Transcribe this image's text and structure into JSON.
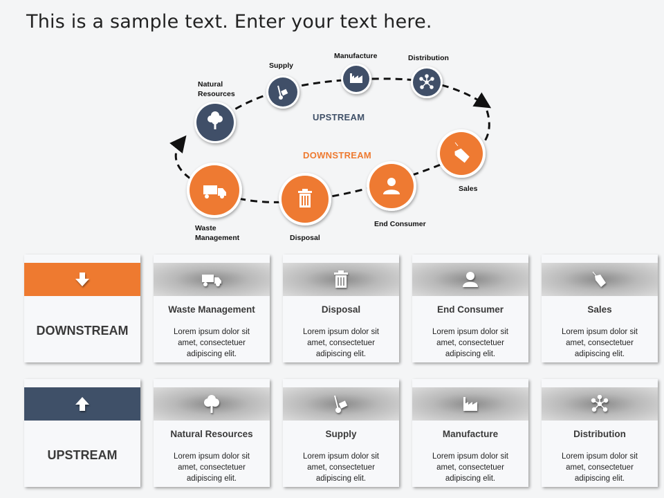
{
  "title": "This is a sample text. Enter your text here.",
  "colors": {
    "orange": "#ee7a30",
    "navy": "#3f5068",
    "dash": "#111111"
  },
  "diagram": {
    "upstream_label": "UPSTREAM",
    "downstream_label": "DOWNSTREAM",
    "upstream_nodes": [
      {
        "label": "Natural Resources",
        "icon": "tree-icon"
      },
      {
        "label": "Supply",
        "icon": "hand-truck-icon"
      },
      {
        "label": "Manufacture",
        "icon": "factory-icon"
      },
      {
        "label": "Distribution",
        "icon": "network-icon"
      }
    ],
    "downstream_nodes": [
      {
        "label": "Sales",
        "icon": "price-tag-icon"
      },
      {
        "label": "End Consumer",
        "icon": "user-icon"
      },
      {
        "label": "Disposal",
        "icon": "trash-icon"
      },
      {
        "label": "Waste Management",
        "icon": "dump-truck-icon"
      }
    ],
    "label_lines": {
      "natural_resources": [
        "Natural",
        "Resources"
      ],
      "waste_management": [
        "Waste",
        "Management"
      ]
    }
  },
  "downstream_row": {
    "header": {
      "label": "DOWNSTREAM",
      "icon": "arrow-down-icon"
    },
    "cards": [
      {
        "title": "Waste Management",
        "icon": "dump-truck-icon",
        "body": "Lorem  ipsum dolor sit amet, consectetuer adipiscing elit."
      },
      {
        "title": "Disposal",
        "icon": "trash-icon",
        "body": "Lorem  ipsum dolor sit amet, consectetuer adipiscing elit."
      },
      {
        "title": "End Consumer",
        "icon": "user-icon",
        "body": "Lorem  ipsum dolor sit amet, consectetuer adipiscing elit."
      },
      {
        "title": "Sales",
        "icon": "price-tag-icon",
        "body": "Lorem  ipsum dolor sit amet, consectetuer adipiscing elit."
      }
    ]
  },
  "upstream_row": {
    "header": {
      "label": "UPSTREAM",
      "icon": "arrow-up-icon"
    },
    "cards": [
      {
        "title": "Natural Resources",
        "icon": "tree-icon",
        "body": "Lorem  ipsum dolor sit amet, consectetuer adipiscing elit."
      },
      {
        "title": "Supply",
        "icon": "hand-truck-icon",
        "body": "Lorem  ipsum dolor sit amet, consectetuer adipiscing elit."
      },
      {
        "title": "Manufacture",
        "icon": "factory-icon",
        "body": "Lorem  ipsum dolor sit amet, consectetuer adipiscing elit."
      },
      {
        "title": "Distribution",
        "icon": "network-icon",
        "body": "Lorem  ipsum dolor sit amet, consectetuer adipiscing elit."
      }
    ]
  }
}
